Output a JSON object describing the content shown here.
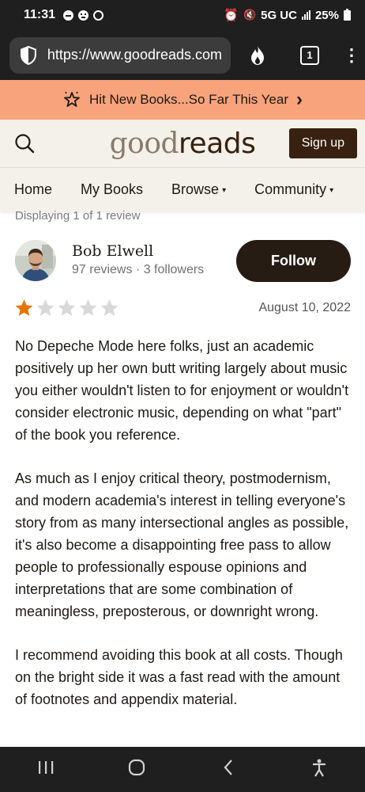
{
  "status_bar": {
    "time": "11:31",
    "network": "5G UC",
    "battery": "25%"
  },
  "browser": {
    "url": "https://www.goodreads.com",
    "tab_count": "1"
  },
  "promo": {
    "text": "Hit New Books...So Far This Year",
    "arrow": "›"
  },
  "header": {
    "logo_part1": "good",
    "logo_part2": "reads",
    "signup_label": "Sign up"
  },
  "nav": {
    "items": [
      {
        "label": "Home"
      },
      {
        "label": "My Books"
      },
      {
        "label": "Browse",
        "caret": "▾"
      },
      {
        "label": "Community",
        "caret": "▾"
      }
    ]
  },
  "review": {
    "displaying": "Displaying 1 of 1 review",
    "reviewer_name": "Bob Elwell",
    "reviewer_stats": "97 reviews · 3 followers",
    "follow_label": "Follow",
    "rating": 1,
    "max_rating": 5,
    "date": "August 10, 2022",
    "paragraphs": [
      "No Depeche Mode here folks, just an academic positively up her own butt writing largely about music you either wouldn't listen to for enjoyment or wouldn't consider electronic music, depending on what \"part\" of the book you reference.",
      "As much as I enjoy critical theory, postmodernism, and modern academia's interest in telling everyone's story from as many intersectional angles as possible, it's also become a disappointing free pass to allow people to professionally espouse opinions and interpretations that are some combination of meaningless, preposterous, or downright wrong.",
      "I recommend avoiding this book at all costs. Though on the bright side it was a fast read with the amount of footnotes and appendix material."
    ]
  },
  "colors": {
    "promo_bg": "#f8a37b",
    "header_bg": "#f4f1ea",
    "brand_dark": "#382110",
    "star_filled": "#e87400",
    "star_empty": "#d8d8d8"
  }
}
